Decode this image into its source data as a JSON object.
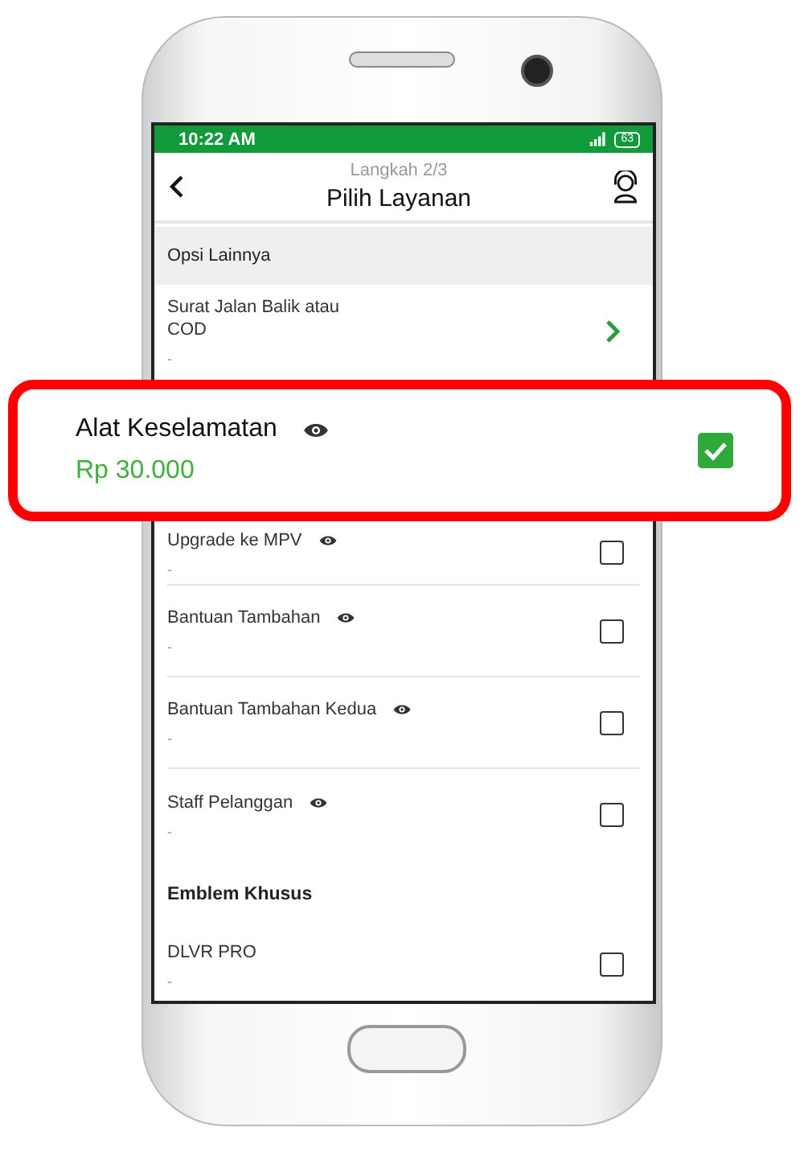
{
  "status_bar": {
    "time": "10:22 AM",
    "battery": "63"
  },
  "header": {
    "step": "Langkah 2/3",
    "title": "Pilih Layanan"
  },
  "sections": [
    {
      "kind": "band",
      "title": "Opsi Lainnya",
      "items": [
        {
          "kind": "link",
          "name": "Surat Jalan Balik atau COD",
          "price": "-"
        },
        {
          "kind": "hidden"
        },
        {
          "kind": "checkbox",
          "name": "Upgrade ke MPV",
          "price": "-",
          "info": true,
          "checked": false
        },
        {
          "kind": "checkbox",
          "name": "Bantuan Tambahan",
          "price": "-",
          "info": true,
          "checked": false
        },
        {
          "kind": "checkbox",
          "name": "Bantuan Tambahan Kedua",
          "price": "-",
          "info": true,
          "checked": false
        },
        {
          "kind": "checkbox",
          "name": "Staff Pelanggan",
          "price": "-",
          "info": true,
          "checked": false
        }
      ]
    },
    {
      "kind": "plain",
      "title": "Emblem Khusus",
      "items": [
        {
          "kind": "checkbox",
          "name": "DLVR PRO",
          "price": "-",
          "info": false,
          "checked": false
        }
      ]
    }
  ],
  "callout": {
    "name": "Alat Keselamatan",
    "price": "Rp 30.000",
    "info": true,
    "checked": true
  }
}
